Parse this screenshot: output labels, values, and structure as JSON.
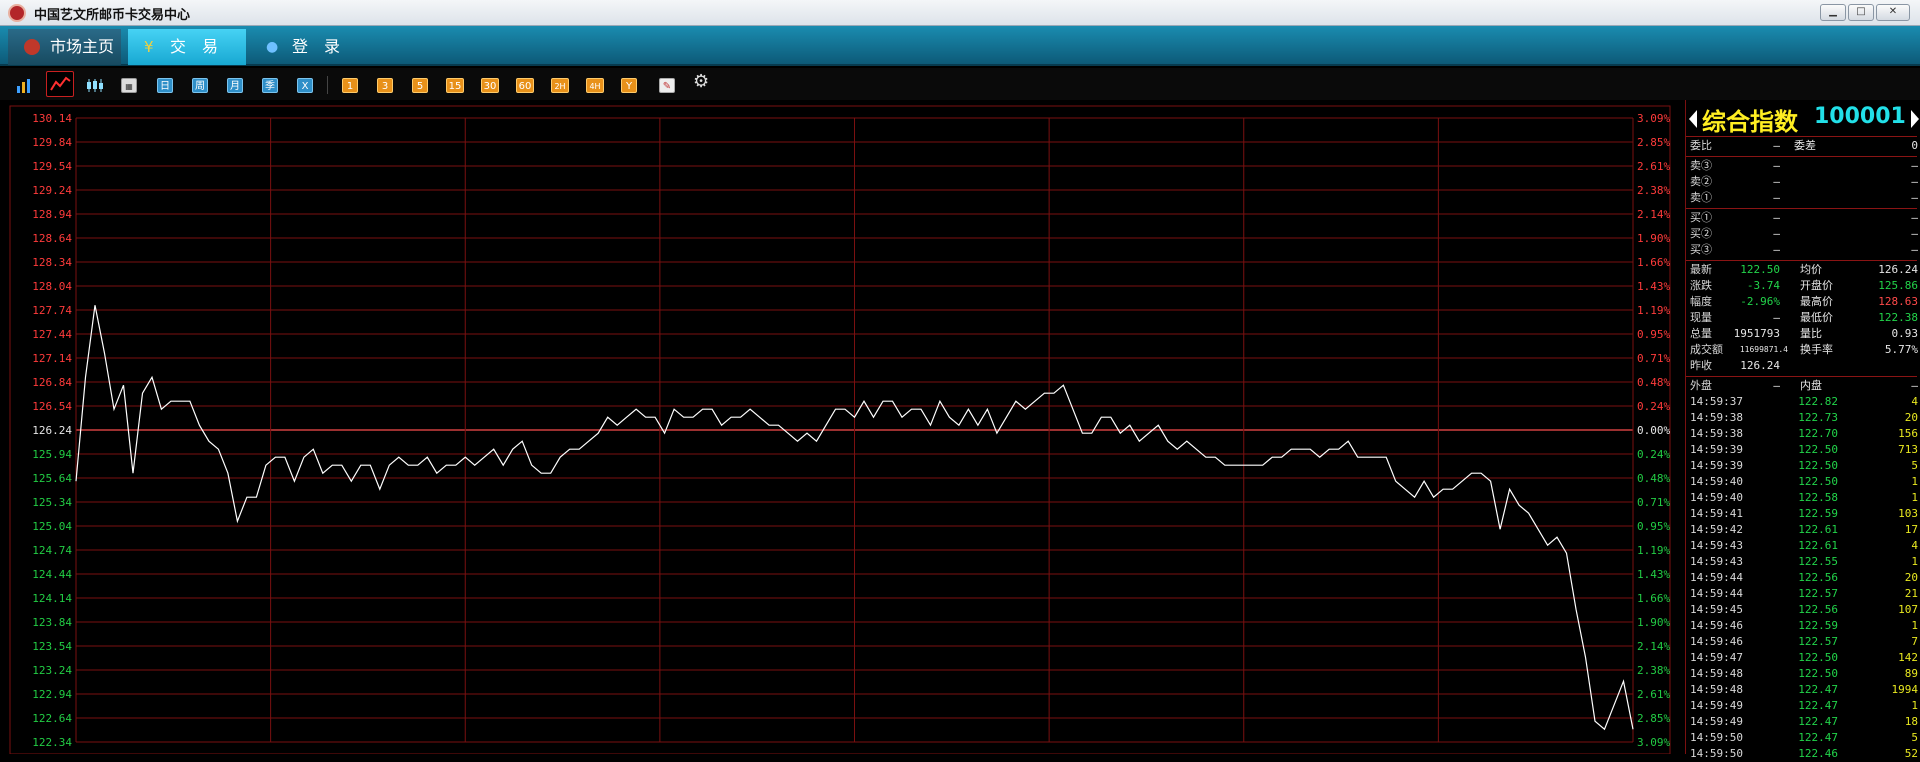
{
  "window": {
    "title": "中国艺文所邮币卡交易中心"
  },
  "nav": {
    "home": "市场主页",
    "trade": "交　易",
    "login": "登　录"
  },
  "toolbar": {
    "tools": [
      {
        "name": "bar-chart-icon"
      },
      {
        "name": "line-chart-icon"
      },
      {
        "name": "candlestick-icon"
      },
      {
        "name": "calendar-icon"
      }
    ],
    "periods": [
      "日",
      "周",
      "月",
      "季",
      "X"
    ],
    "intervals": [
      "1",
      "3",
      "5",
      "15",
      "30",
      "60",
      "2H",
      "4H",
      "Y"
    ],
    "extra": [
      {
        "name": "pencil-icon"
      },
      {
        "name": "gear-icon"
      }
    ]
  },
  "chart_data": {
    "type": "line",
    "title": "",
    "price_ticks": [
      "130.14",
      "129.84",
      "129.54",
      "129.24",
      "128.94",
      "128.64",
      "128.34",
      "128.04",
      "127.74",
      "127.44",
      "127.14",
      "126.84",
      "126.54",
      "126.24",
      "125.94",
      "125.64",
      "125.34",
      "125.04",
      "124.74",
      "124.44",
      "124.14",
      "123.84",
      "123.54",
      "123.24",
      "122.94",
      "122.64",
      "122.34"
    ],
    "pct_ticks": [
      "3.09%",
      "2.85%",
      "2.61%",
      "2.38%",
      "2.14%",
      "1.90%",
      "1.66%",
      "1.43%",
      "1.19%",
      "0.95%",
      "0.71%",
      "0.48%",
      "0.24%",
      "0.00%",
      "0.24%",
      "0.48%",
      "0.71%",
      "0.95%",
      "1.19%",
      "1.43%",
      "1.66%",
      "1.90%",
      "2.14%",
      "2.38%",
      "2.61%",
      "2.85%",
      "3.09%"
    ],
    "ylim": [
      122.34,
      130.14
    ],
    "prev_close": 126.24,
    "colors": {
      "up": "#ff3b3b",
      "down": "#22cc44",
      "flat": "#e6e6e6",
      "grid": "#7a1010",
      "line": "#ffffff"
    },
    "series": [
      {
        "values": [
          125.6,
          126.9,
          127.8,
          127.2,
          126.5,
          126.8,
          125.7,
          126.7,
          126.9,
          126.5,
          126.6,
          126.6,
          126.6,
          126.3,
          126.1,
          126.0,
          125.7,
          125.1,
          125.4,
          125.4,
          125.8,
          125.9,
          125.9,
          125.6,
          125.9,
          126.0,
          125.7,
          125.8,
          125.8,
          125.6,
          125.8,
          125.8,
          125.5,
          125.8,
          125.9,
          125.8,
          125.8,
          125.9,
          125.7,
          125.8,
          125.8,
          125.9,
          125.8,
          125.9,
          126.0,
          125.8,
          126.0,
          126.1,
          125.8,
          125.7,
          125.7,
          125.9,
          126.0,
          126.0,
          126.1,
          126.2,
          126.4,
          126.3,
          126.4,
          126.5,
          126.4,
          126.4,
          126.2,
          126.5,
          126.4,
          126.4,
          126.5,
          126.5,
          126.3,
          126.4,
          126.4,
          126.5,
          126.4,
          126.3,
          126.3,
          126.2,
          126.1,
          126.2,
          126.1,
          126.3,
          126.5,
          126.5,
          126.4,
          126.6,
          126.4,
          126.6,
          126.6,
          126.4,
          126.5,
          126.5,
          126.3,
          126.6,
          126.4,
          126.3,
          126.5,
          126.3,
          126.5,
          126.2,
          126.4,
          126.6,
          126.5,
          126.6,
          126.7,
          126.7,
          126.8,
          126.5,
          126.2,
          126.2,
          126.4,
          126.4,
          126.2,
          126.3,
          126.1,
          126.2,
          126.3,
          126.1,
          126.0,
          126.1,
          126.0,
          125.9,
          125.9,
          125.8,
          125.8,
          125.8,
          125.8,
          125.8,
          125.9,
          125.9,
          126.0,
          126.0,
          126.0,
          125.9,
          126.0,
          126.0,
          126.1,
          125.9,
          125.9,
          125.9,
          125.9,
          125.6,
          125.5,
          125.4,
          125.6,
          125.4,
          125.5,
          125.5,
          125.6,
          125.7,
          125.7,
          125.6,
          125.0,
          125.5,
          125.3,
          125.2,
          125.0,
          124.8,
          124.9,
          124.7,
          124.0,
          123.4,
          122.6,
          122.5,
          122.8,
          123.1,
          122.5
        ]
      }
    ],
    "xlabel": "",
    "ylabel": ""
  },
  "quote": {
    "name": "综合指数",
    "code": "100001",
    "wb": {
      "l1": "委比",
      "v1": "—",
      "l2": "委差",
      "v2": "0"
    },
    "asks": [
      {
        "l": "卖③",
        "p": "—",
        "v": "—"
      },
      {
        "l": "卖②",
        "p": "—",
        "v": "—"
      },
      {
        "l": "卖①",
        "p": "—",
        "v": "—"
      }
    ],
    "bids": [
      {
        "l": "买①",
        "p": "—",
        "v": "—"
      },
      {
        "l": "买②",
        "p": "—",
        "v": "—"
      },
      {
        "l": "买③",
        "p": "—",
        "v": "—"
      }
    ],
    "stats": [
      {
        "l1": "最新",
        "v1": "122.50",
        "l2": "均价",
        "v2": "126.24",
        "c1": "g",
        "c2": "w"
      },
      {
        "l1": "涨跌",
        "v1": "-3.74",
        "l2": "开盘价",
        "v2": "125.86",
        "c1": "g",
        "c2": "g"
      },
      {
        "l1": "幅度",
        "v1": "-2.96%",
        "l2": "最高价",
        "v2": "128.63",
        "c1": "g",
        "c2": "r"
      },
      {
        "l1": "现量",
        "v1": "—",
        "l2": "最低价",
        "v2": "122.38",
        "c1": "w",
        "c2": "g"
      },
      {
        "l1": "总量",
        "v1": "1951793",
        "l2": "量比",
        "v2": "0.93",
        "c1": "w",
        "c2": "w"
      },
      {
        "l1": "成交额",
        "v1": "11699871.4",
        "l2": "换手率",
        "v2": "5.77%",
        "c1": "w",
        "c2": "w"
      },
      {
        "l1": "昨收",
        "v1": "126.24",
        "l2": "",
        "v2": "",
        "c1": "w",
        "c2": "w"
      }
    ],
    "outer": {
      "l1": "外盘",
      "v1": "—",
      "l2": "内盘",
      "v2": "—"
    },
    "ticks": [
      {
        "t": "14:59:37",
        "p": "122.82",
        "v": "4"
      },
      {
        "t": "14:59:38",
        "p": "122.73",
        "v": "20"
      },
      {
        "t": "14:59:38",
        "p": "122.70",
        "v": "156"
      },
      {
        "t": "14:59:39",
        "p": "122.50",
        "v": "713"
      },
      {
        "t": "14:59:39",
        "p": "122.50",
        "v": "5"
      },
      {
        "t": "14:59:40",
        "p": "122.50",
        "v": "1"
      },
      {
        "t": "14:59:40",
        "p": "122.58",
        "v": "1"
      },
      {
        "t": "14:59:41",
        "p": "122.59",
        "v": "103"
      },
      {
        "t": "14:59:42",
        "p": "122.61",
        "v": "17"
      },
      {
        "t": "14:59:43",
        "p": "122.61",
        "v": "4"
      },
      {
        "t": "14:59:43",
        "p": "122.55",
        "v": "1"
      },
      {
        "t": "14:59:44",
        "p": "122.56",
        "v": "20"
      },
      {
        "t": "14:59:44",
        "p": "122.57",
        "v": "21"
      },
      {
        "t": "14:59:45",
        "p": "122.56",
        "v": "107"
      },
      {
        "t": "14:59:46",
        "p": "122.59",
        "v": "1"
      },
      {
        "t": "14:59:46",
        "p": "122.57",
        "v": "7"
      },
      {
        "t": "14:59:47",
        "p": "122.50",
        "v": "142"
      },
      {
        "t": "14:59:48",
        "p": "122.50",
        "v": "89"
      },
      {
        "t": "14:59:48",
        "p": "122.47",
        "v": "1994"
      },
      {
        "t": "14:59:49",
        "p": "122.47",
        "v": "1"
      },
      {
        "t": "14:59:49",
        "p": "122.47",
        "v": "18"
      },
      {
        "t": "14:59:50",
        "p": "122.47",
        "v": "5"
      },
      {
        "t": "14:59:50",
        "p": "122.46",
        "v": "52"
      }
    ]
  }
}
